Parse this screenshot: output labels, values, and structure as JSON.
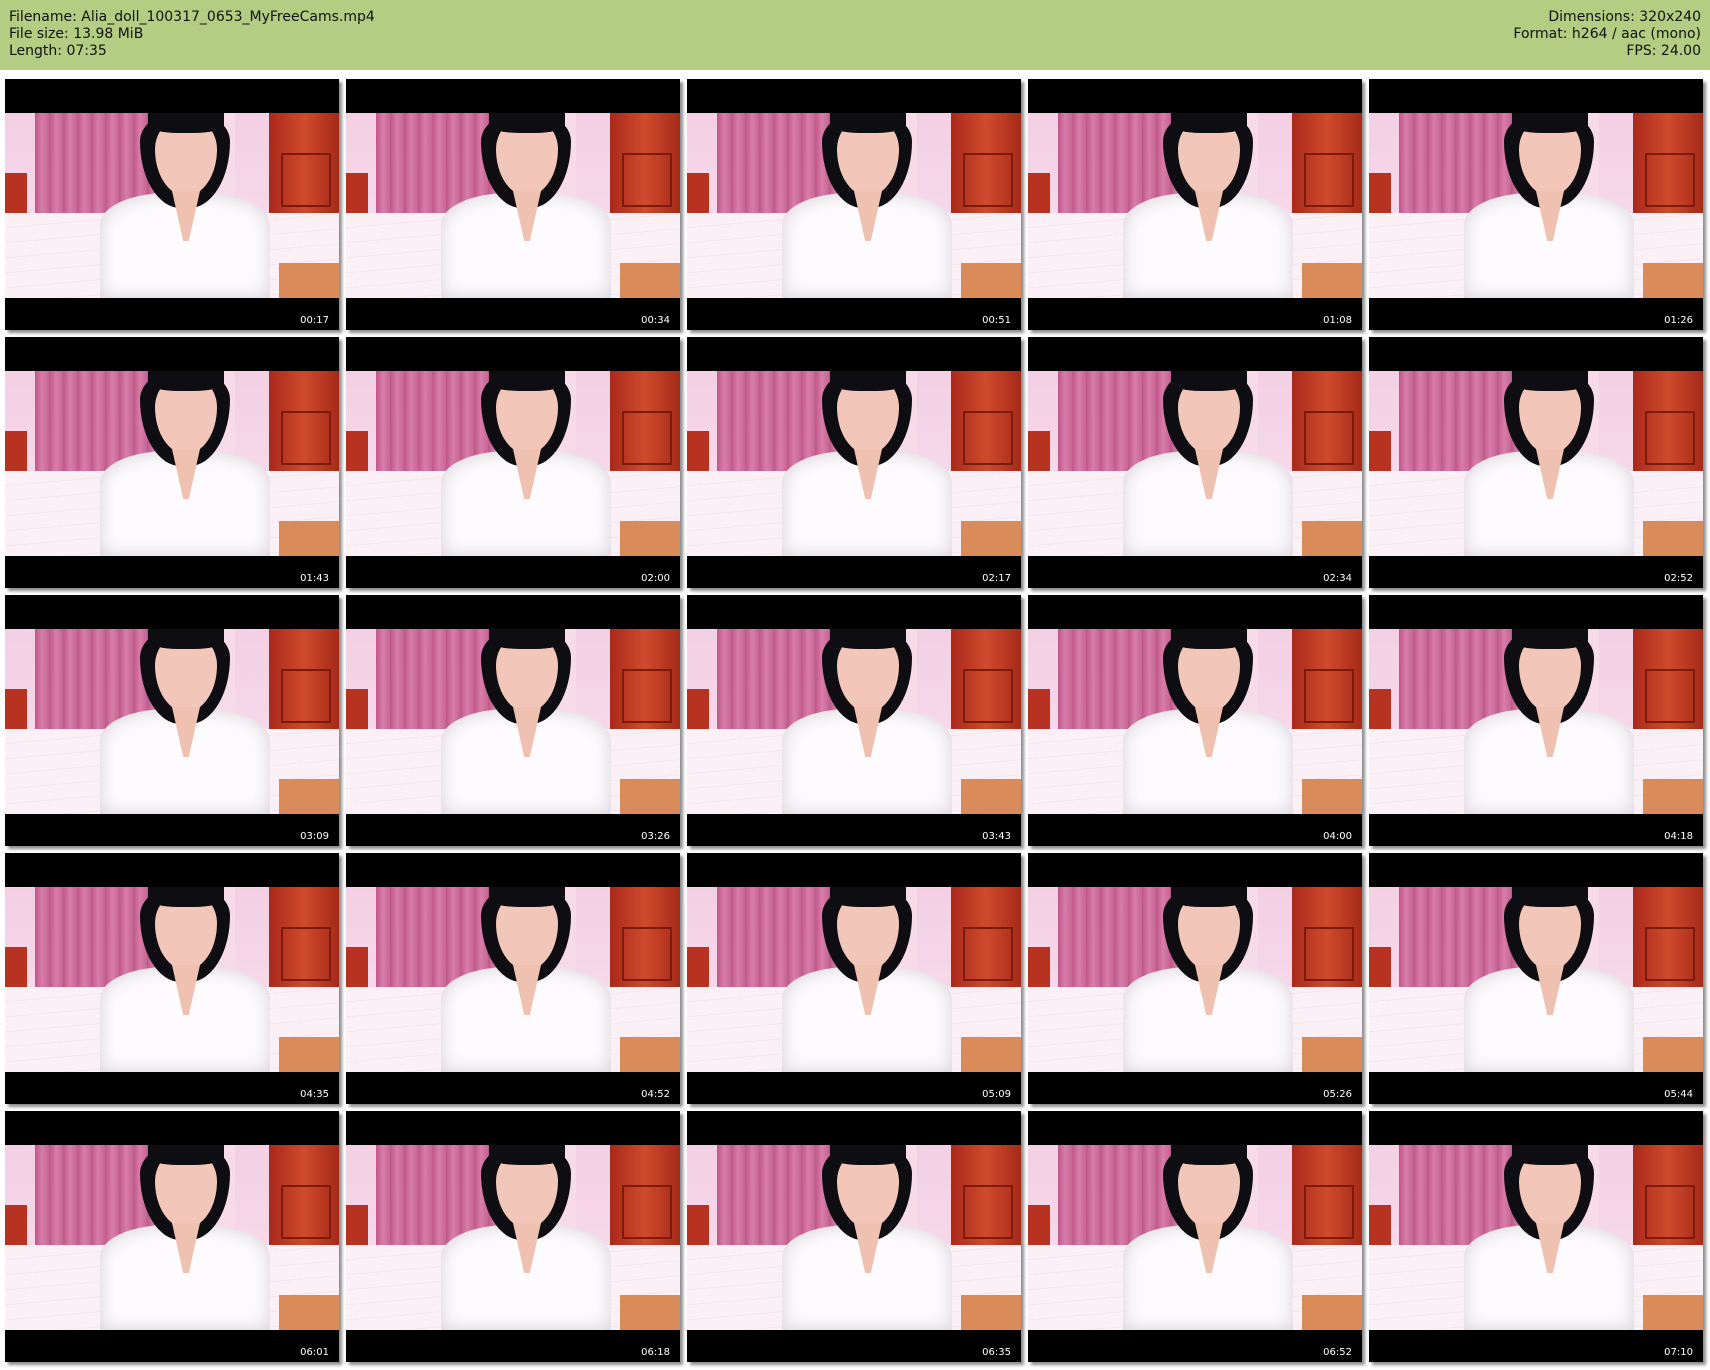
{
  "header": {
    "filename": "Filename: Alia_doll_100317_0653_MyFreeCams.mp4",
    "filesize": "File size: 13.98 MiB",
    "length": "Length: 07:35",
    "dimensions": "Dimensions: 320x240",
    "format": "Format: h264 / aac (mono)",
    "fps": "FPS: 24.00"
  },
  "colors": {
    "header_bg": "#b3cd82",
    "page_bg": "#ffffff",
    "thumb_bg": "#000000",
    "timestamp_text": "#ffffff"
  },
  "thumbnails": [
    {
      "time": "00:17"
    },
    {
      "time": "00:34"
    },
    {
      "time": "00:51"
    },
    {
      "time": "01:08"
    },
    {
      "time": "01:26"
    },
    {
      "time": "01:43"
    },
    {
      "time": "02:00"
    },
    {
      "time": "02:17"
    },
    {
      "time": "02:34"
    },
    {
      "time": "02:52"
    },
    {
      "time": "03:09"
    },
    {
      "time": "03:26"
    },
    {
      "time": "03:43"
    },
    {
      "time": "04:00"
    },
    {
      "time": "04:18"
    },
    {
      "time": "04:35"
    },
    {
      "time": "04:52"
    },
    {
      "time": "05:09"
    },
    {
      "time": "05:26"
    },
    {
      "time": "05:44"
    },
    {
      "time": "06:01"
    },
    {
      "time": "06:18"
    },
    {
      "time": "06:35"
    },
    {
      "time": "06:52"
    },
    {
      "time": "07:10"
    }
  ]
}
